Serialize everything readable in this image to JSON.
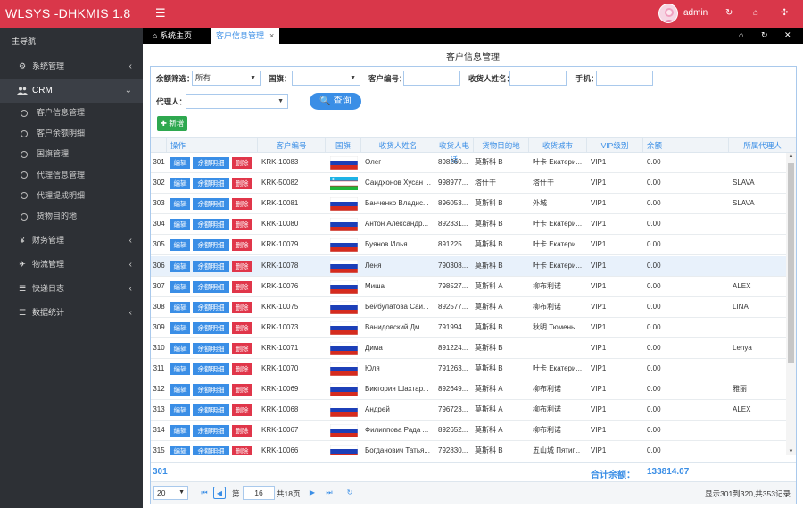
{
  "brand": {
    "title": "WLSYS -DHKMIS 1.8"
  },
  "sidebar": {
    "header": "主导航",
    "items": [
      {
        "label": "系统管理",
        "icon": "gears-icon",
        "glyph": "⚙"
      },
      {
        "label": "CRM",
        "icon": "users-icon",
        "glyph": "👥",
        "open": true
      },
      {
        "label": "财务管理",
        "icon": "yen-icon",
        "glyph": "¥"
      },
      {
        "label": "物流管理",
        "icon": "plane-icon",
        "glyph": "✈"
      },
      {
        "label": "快递日志",
        "icon": "list-icon",
        "glyph": "☰"
      },
      {
        "label": "数据统计",
        "icon": "list-icon",
        "glyph": "☰"
      }
    ],
    "crm_sub": [
      "客户信息管理",
      "客户余额明细",
      "国旗管理",
      "代理信息管理",
      "代理提成明细",
      "货物目的地"
    ]
  },
  "topbar": {
    "user": "admin"
  },
  "tabs": {
    "home": "系统主页",
    "active": "客户信息管理"
  },
  "page_title": "客户信息管理",
  "filters": {
    "balance_label": "余额筛选：",
    "balance_value": "所有",
    "country_label": "国旗：",
    "customer_no_label": "客户编号：",
    "receiver_label": "收货人姓名：",
    "phone_label": "手机：",
    "agent_label": "代理人：",
    "search_label": "查询"
  },
  "add_label": "新增",
  "columns": [
    "操作",
    "客户编号",
    "国旗",
    "收货人姓名",
    "收货人电话",
    "货物目的地",
    "收货城市",
    "VIP级别",
    "余额",
    "所属代理人"
  ],
  "actions": {
    "edit": "编辑",
    "balance": "余额明细",
    "delete": "删除"
  },
  "rows": [
    {
      "n": "301",
      "id": "KRK-10083",
      "flag": "ru",
      "name": "Олег",
      "phone": "898260...",
      "dest": "莫斯科 B",
      "city": "叶卡 Екатери...",
      "vip": "VIP1",
      "bal": "0.00",
      "agent": ""
    },
    {
      "n": "302",
      "id": "KRK-50082",
      "flag": "uz",
      "name": "Саидхонов Хусан ...",
      "phone": "998977...",
      "dest": "塔什干",
      "city": "塔什干",
      "vip": "VIP1",
      "bal": "0.00",
      "agent": "SLAVA"
    },
    {
      "n": "303",
      "id": "KRK-10081",
      "flag": "ru",
      "name": "Банченко Владис...",
      "phone": "896053...",
      "dest": "莫斯科 B",
      "city": "外城",
      "vip": "VIP1",
      "bal": "0.00",
      "agent": "SLAVA"
    },
    {
      "n": "304",
      "id": "KRK-10080",
      "flag": "ru",
      "name": "Антон Александр...",
      "phone": "892331...",
      "dest": "莫斯科 B",
      "city": "叶卡 Екатери...",
      "vip": "VIP1",
      "bal": "0.00",
      "agent": ""
    },
    {
      "n": "305",
      "id": "KRK-10079",
      "flag": "ru",
      "name": "Буянов Илья",
      "phone": "891225...",
      "dest": "莫斯科 B",
      "city": "叶卡 Екатери...",
      "vip": "VIP1",
      "bal": "0.00",
      "agent": ""
    },
    {
      "n": "306",
      "id": "KRK-10078",
      "flag": "ru",
      "name": "Леня",
      "phone": "790308...",
      "dest": "莫斯科 B",
      "city": "叶卡 Екатери...",
      "vip": "VIP1",
      "bal": "0.00",
      "agent": "",
      "sel": true
    },
    {
      "n": "307",
      "id": "KRK-10076",
      "flag": "ru",
      "name": "Миша",
      "phone": "798527...",
      "dest": "莫斯科 A",
      "city": "柳布利诺",
      "vip": "VIP1",
      "bal": "0.00",
      "agent": "ALEX"
    },
    {
      "n": "308",
      "id": "KRK-10075",
      "flag": "ru",
      "name": "Бейбулатова Саи...",
      "phone": "892577...",
      "dest": "莫斯科 A",
      "city": "柳布利诺",
      "vip": "VIP1",
      "bal": "0.00",
      "agent": "LINA"
    },
    {
      "n": "309",
      "id": "KRK-10073",
      "flag": "ru",
      "name": "Ванидовский Дм...",
      "phone": "791994...",
      "dest": "莫斯科 B",
      "city": "秋明 Тюмень",
      "vip": "VIP1",
      "bal": "0.00",
      "agent": ""
    },
    {
      "n": "310",
      "id": "KRK-10071",
      "flag": "ru",
      "name": "Дима",
      "phone": "891224...",
      "dest": "莫斯科 B",
      "city": "",
      "vip": "VIP1",
      "bal": "0.00",
      "agent": "Lenya"
    },
    {
      "n": "311",
      "id": "KRK-10070",
      "flag": "ru",
      "name": "Юля",
      "phone": "791263...",
      "dest": "莫斯科 B",
      "city": "叶卡 Екатери...",
      "vip": "VIP1",
      "bal": "0.00",
      "agent": ""
    },
    {
      "n": "312",
      "id": "KRK-10069",
      "flag": "ru",
      "name": "Виктория Шахтар...",
      "phone": "892649...",
      "dest": "莫斯科 A",
      "city": "柳布利诺",
      "vip": "VIP1",
      "bal": "0.00",
      "agent": "雅丽"
    },
    {
      "n": "313",
      "id": "KRK-10068",
      "flag": "ru",
      "name": "Андрей",
      "phone": "796723...",
      "dest": "莫斯科 A",
      "city": "柳布利诺",
      "vip": "VIP1",
      "bal": "0.00",
      "agent": "ALEX"
    },
    {
      "n": "314",
      "id": "KRK-10067",
      "flag": "ru",
      "name": "Филиппова Рада ...",
      "phone": "892652...",
      "dest": "莫斯科 A",
      "city": "柳布利诺",
      "vip": "VIP1",
      "bal": "0.00",
      "agent": ""
    },
    {
      "n": "315",
      "id": "KRK-10066",
      "flag": "ru",
      "name": "Богданович Татья...",
      "phone": "792830...",
      "dest": "莫斯科 B",
      "city": "五山城 Пятиг...",
      "vip": "VIP1",
      "bal": "0.00",
      "agent": ""
    }
  ],
  "footer": {
    "count": "301",
    "total_label": "合计余额：",
    "total_value": "133814.07"
  },
  "pager": {
    "size": "20",
    "page_prefix": "第",
    "page": "16",
    "page_suffix": "共18页",
    "info": "显示301到320,共353记录"
  },
  "colors": {
    "accent": "#d9374a",
    "primary": "#3a8ee6",
    "danger": "#e0364a",
    "success": "#2ea84f",
    "sidebar": "#2d3035"
  }
}
